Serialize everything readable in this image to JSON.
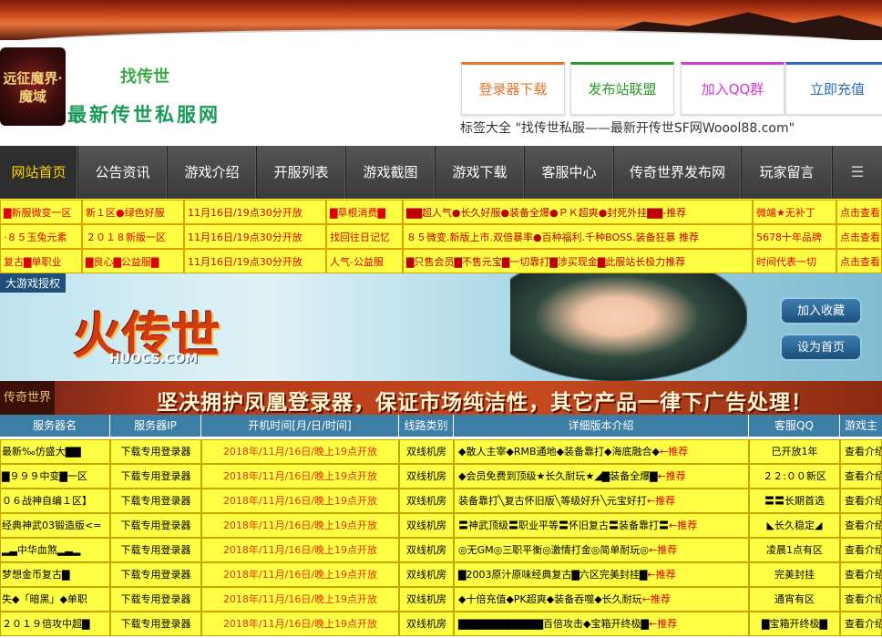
{
  "header": {
    "logo_text": "远征魔界·魔域",
    "slogan_line1": "找传世",
    "slogan_line2": "最新传世私服网",
    "buttons": [
      {
        "label": "登录器下载",
        "color": "#e8742a"
      },
      {
        "label": "发布站联盟",
        "color": "#2a9a2a"
      },
      {
        "label": "加入QQ群",
        "color": "#d23ad2"
      },
      {
        "label": "立即充值",
        "color": "#2a6ab8"
      }
    ],
    "tagline": "标签大全 \"找传世私服——最新开传世SF网Woool88.com\""
  },
  "nav": {
    "items": [
      "网站首页",
      "公告资讯",
      "游戏介绍",
      "开服列表",
      "游戏截图",
      "游戏下载",
      "客服中心",
      "传奇世界发布网",
      "玩家留言"
    ],
    "menu_icon": "menu-icon"
  },
  "ads": [
    [
      "▇新服微变一区",
      "新１区●绿色好服",
      "11月16日/19点30分开放",
      "▇草根消费▇",
      "▇▇超人气●长久好服●装备全爆●ＰＫ超爽●封死外挂▇▇-推荐",
      "微端★无补丁",
      "点击查看"
    ],
    [
      "·８５玉兔元素",
      "２０１８新版一区",
      "11月16日/19点30分开放",
      "找回往日记忆",
      "８５微变.新版上市.双倍暴率●百种福利.千种BOSS.装备狂暴 推荐",
      "5678十年品牌",
      "点击查看"
    ],
    [
      "复古▇单职业",
      "▇良心▇公益服▇",
      "11月16日/19点30分开放",
      "人气-公益服",
      "▇只售会员▇不售元宝▇一切靠打▇涉买现金▇此服站长极力推荐",
      "时间代表一切",
      "点击查看"
    ]
  ],
  "banner": {
    "tag": "大游戏授权",
    "logo": "火传世",
    "site": "HUOCS.COM",
    "btn_fav": "加入收藏",
    "btn_home": "设为首页"
  },
  "notice": {
    "left": "传奇世界",
    "text": "坚决拥护凤凰登录器，保证市场纯洁性，其它产品一律下广告处理！"
  },
  "table": {
    "headers": [
      "服务器名",
      "服务器IP",
      "开机时间[月/日/时间]",
      "线路类别",
      "详细版本介绍",
      "客服QQ",
      "游戏主页"
    ],
    "rows": [
      {
        "name": "最新‰仿盛大▇▇",
        "ip": "下载专用登录器",
        "time": "2018年/11月/16日/晚上19点开放",
        "line": "双线机房",
        "desc": "◆散人主宰◆RMB通地◆装备靠打◆海底融合◆",
        "rec": "←推荐",
        "qq": "已开放1年",
        "intro": "查看介绍"
      },
      {
        "name": "▇９９９中变▇一区",
        "ip": "下载专用登录器",
        "time": "2018年/11月/16日/晚上19点开放",
        "line": "双线机房",
        "desc": "◆会员免费到顶级★长久耐玩★◢▇装备全爆▇",
        "rec": "←推荐",
        "qq": "２２:００新区",
        "intro": "查看介绍"
      },
      {
        "name": "０６战神自编１区】",
        "ip": "下载专用登录器",
        "time": "2018年/11月/16日/晚上19点开放",
        "line": "双线机房",
        "desc": "装备靠打╲复古怀旧版╲等级好升╲元宝好打",
        "rec": "←推荐",
        "qq": "〓〓长期首选",
        "intro": "查看介绍"
      },
      {
        "name": "经典神武03锻造版<=",
        "ip": "下载专用登录器",
        "time": "2018年/11月/16日/晚上19点开放",
        "line": "双线机房",
        "desc": "〓神武顶级〓职业平等〓怀旧复古〓装备靠打〓",
        "rec": "←推荐",
        "qq": "◣长久稳定◢",
        "intro": "查看介绍"
      },
      {
        "name": "▂▃中华血煞▂▃▂",
        "ip": "下载专用登录器",
        "time": "2018年/11月/16日/晚上19点开放",
        "line": "双线机房",
        "desc": "◎无GM◎三职平衡◎激情打金◎简单耐玩◎",
        "rec": "←推荐",
        "qq": "凌晨1点有区",
        "intro": "查看介绍"
      },
      {
        "name": "梦想金币复古▇",
        "ip": "下载专用登录器",
        "time": "2018年/11月/16日/晚上19点开放",
        "line": "双线机房",
        "desc": "▇2003原汁原味经典复古▇六区完美封挂▇",
        "rec": "←推荐",
        "qq": "完美封挂",
        "intro": "查看介绍"
      },
      {
        "name": "失◆「暗黑」◆单职",
        "ip": "下载专用登录器",
        "time": "2018年/11月/16日/晚上19点开放",
        "line": "双线机房",
        "desc": "◆十倍充值◆PK超爽◆装备吞噬◆长久耐玩",
        "rec": "←推荐",
        "qq": "通宵有区",
        "intro": "查看介绍"
      },
      {
        "name": "２０１９倍攻中超▇",
        "ip": "下载专用登录器",
        "time": "2018年/11月/16日/晚上19点开放",
        "line": "双线机房",
        "desc": "▇▇▇▇▇▇▇▇▇▇▇百倍攻击◆宝箱开终极▇",
        "rec": "←推荐",
        "qq": "▇宝箱开终极▇",
        "intro": "查看介绍"
      }
    ]
  }
}
